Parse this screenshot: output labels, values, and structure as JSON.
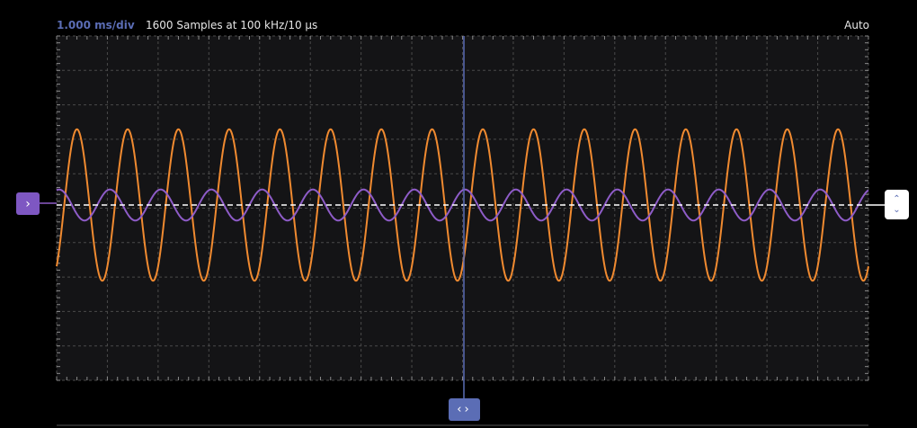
{
  "status": {
    "timebase": "1.000 ms/div",
    "samples": "1600 Samples at 100 kHz/10 µs",
    "trigger_mode": "Auto"
  },
  "handles": {
    "channel_icon": "chevron-right-icon",
    "trigger_up_icon": "chevron-up-icon",
    "trigger_down_icon": "chevron-down-icon",
    "time_icon": "chevron-left-right-icon"
  },
  "colors": {
    "background": "#000000",
    "plot_background": "#141416",
    "grid": "#4a4a4a",
    "channel_a": "#f08a30",
    "channel_b": "#8e5cc8",
    "cursor": "#5b6db5",
    "trigger_line": "#ffffff"
  },
  "chart_data": {
    "type": "line",
    "grid": true,
    "divisions": {
      "x": 16,
      "y": 10
    },
    "series": [
      {
        "waveform": "sine",
        "cycles": 16,
        "amplitude_div": 2.2,
        "phase_start": 0.85,
        "color": "#f08a30"
      },
      {
        "waveform": "sine",
        "cycles": 16,
        "amplitude_div": 0.45,
        "phase_start": 0.2,
        "color": "#8e5cc8"
      }
    ]
  }
}
